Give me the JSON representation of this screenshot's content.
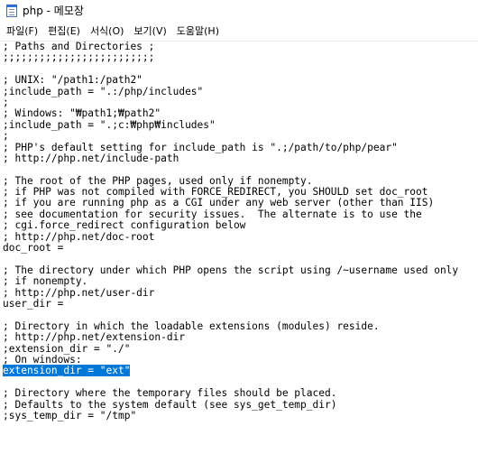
{
  "window": {
    "title": "php - 메모장",
    "icon": "notepad-icon"
  },
  "menu": {
    "items": [
      {
        "name": "menu-file",
        "label": "파일(F)"
      },
      {
        "name": "menu-edit",
        "label": "편집(E)"
      },
      {
        "name": "menu-format",
        "label": "서식(O)"
      },
      {
        "name": "menu-view",
        "label": "보기(V)"
      },
      {
        "name": "menu-help",
        "label": "도움말(H)"
      }
    ]
  },
  "editor": {
    "selection_color": "#0078d7",
    "selected_line_index": 31,
    "lines": [
      "; Paths and Directories ;",
      ";;;;;;;;;;;;;;;;;;;;;;;;;",
      "",
      "; UNIX: \"/path1:/path2\"",
      ";include_path = \".:/php/includes\"",
      ";",
      "; Windows: \"₩path1;₩path2\"",
      ";include_path = \".;c:₩php₩includes\"",
      ";",
      "; PHP's default setting for include_path is \".;/path/to/php/pear\"",
      "; http://php.net/include-path",
      "",
      "; The root of the PHP pages, used only if nonempty.",
      "; if PHP was not compiled with FORCE_REDIRECT, you SHOULD set doc_root",
      "; if you are running php as a CGI under any web server (other than IIS)",
      "; see documentation for security issues.  The alternate is to use the",
      "; cgi.force_redirect configuration below",
      "; http://php.net/doc-root",
      "doc_root =",
      "",
      "; The directory under which PHP opens the script using /~username used only",
      "; if nonempty.",
      "; http://php.net/user-dir",
      "user_dir =",
      "",
      "; Directory in which the loadable extensions (modules) reside.",
      "; http://php.net/extension-dir",
      ";extension_dir = \"./\"",
      "; On windows:",
      "extension_dir = \"ext\"",
      "",
      "; Directory where the temporary files should be placed.",
      "; Defaults to the system default (see sys_get_temp_dir)",
      ";sys_temp_dir = \"/tmp\""
    ]
  }
}
